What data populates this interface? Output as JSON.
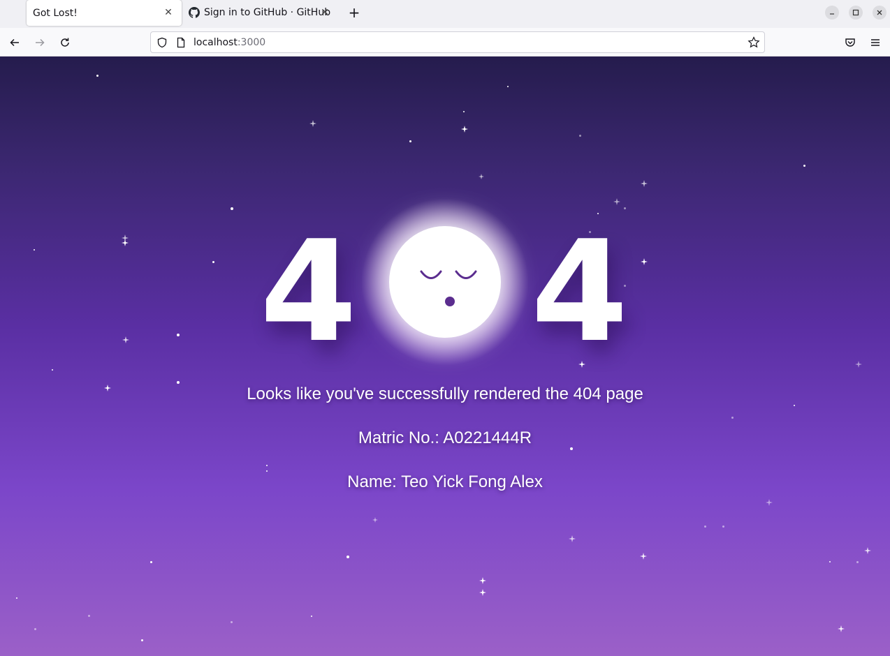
{
  "browser": {
    "tabs": [
      {
        "title": "Got Lost!",
        "active": true
      },
      {
        "title": "Sign in to GitHub · GitHub",
        "active": false
      }
    ],
    "new_tab_label": "+",
    "url_host": "localhost",
    "url_port": ":3000"
  },
  "page": {
    "digit_left": "4",
    "digit_right": "4",
    "message": "Looks like you've successfully rendered the 404 page",
    "matric": "Matric No.: A0221444R",
    "name": "Name: Teo Yick Fong Alex"
  },
  "colors": {
    "accent": "#5b2d8f",
    "page_top": "#251c4d",
    "page_bottom": "#9b60c8"
  }
}
